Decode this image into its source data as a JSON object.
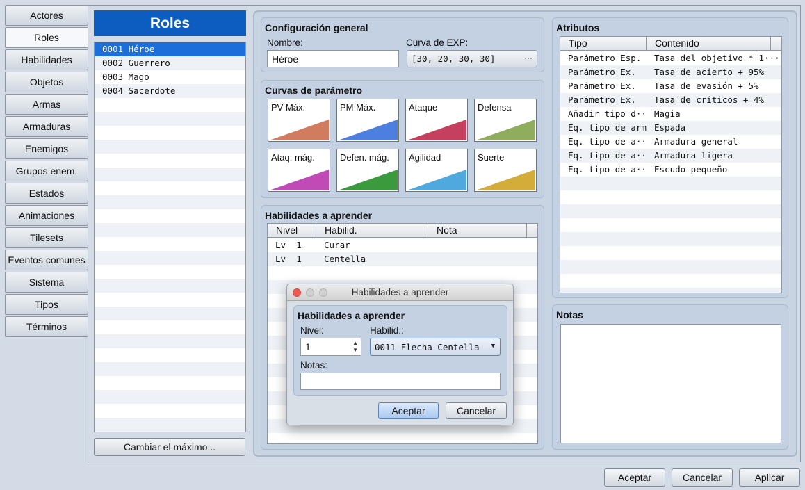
{
  "nav": [
    {
      "label": "Actores",
      "active": false
    },
    {
      "label": "Roles",
      "active": true
    },
    {
      "label": "Habilidades",
      "active": false
    },
    {
      "label": "Objetos",
      "active": false
    },
    {
      "label": "Armas",
      "active": false
    },
    {
      "label": "Armaduras",
      "active": false
    },
    {
      "label": "Enemigos",
      "active": false
    },
    {
      "label": "Grupos enem.",
      "active": false
    },
    {
      "label": "Estados",
      "active": false
    },
    {
      "label": "Animaciones",
      "active": false
    },
    {
      "label": "Tilesets",
      "active": false
    },
    {
      "label": "Eventos comunes",
      "active": false
    },
    {
      "label": "Sistema",
      "active": false
    },
    {
      "label": "Tipos",
      "active": false
    },
    {
      "label": "Términos",
      "active": false
    }
  ],
  "roles": {
    "title": "Roles",
    "items": [
      "0001 Héroe",
      "0002 Guerrero",
      "0003 Mago",
      "0004 Sacerdote"
    ],
    "change_max_label": "Cambiar el máximo..."
  },
  "general": {
    "title": "Configuración general",
    "name_label": "Nombre:",
    "name_value": "Héroe",
    "exp_label": "Curva de EXP:",
    "exp_value": "[30, 20, 30, 30]",
    "exp_button": "···"
  },
  "curves": {
    "title": "Curvas de parámetro",
    "items": [
      {
        "label": "PV Máx.",
        "color": "#d27c5f"
      },
      {
        "label": "PM Máx.",
        "color": "#4d7fe0"
      },
      {
        "label": "Ataque",
        "color": "#c63f5e"
      },
      {
        "label": "Defensa",
        "color": "#8fad5d"
      },
      {
        "label": "Ataq. mág.",
        "color": "#c04ab6"
      },
      {
        "label": "Defen. mág.",
        "color": "#3a9a3c"
      },
      {
        "label": "Agilidad",
        "color": "#4ea9de"
      },
      {
        "label": "Suerte",
        "color": "#d4ac3a"
      }
    ]
  },
  "skills": {
    "title": "Habilidades a aprender",
    "headers": [
      "Nivel",
      "Habilid.",
      "Nota"
    ],
    "rows": [
      {
        "level": "Lv  1",
        "skill": "Curar",
        "note": ""
      },
      {
        "level": "Lv  1",
        "skill": "Centella",
        "note": ""
      }
    ]
  },
  "attributes": {
    "title": "Atributos",
    "headers": [
      "Tipo",
      "Contenido"
    ],
    "rows": [
      {
        "type": "Parámetro Esp.",
        "content": "Tasa del objetivo * 1···"
      },
      {
        "type": "Parámetro Ex.",
        "content": "Tasa de acierto + 95%"
      },
      {
        "type": "Parámetro Ex.",
        "content": "Tasa de evasión + 5%"
      },
      {
        "type": "Parámetro Ex.",
        "content": "Tasa de críticos + 4%"
      },
      {
        "type": "Añadir tipo d···",
        "content": "Magia"
      },
      {
        "type": "Eq. tipo de arma",
        "content": "Espada"
      },
      {
        "type": "Eq. tipo de a···",
        "content": "Armadura general"
      },
      {
        "type": "Eq. tipo de a···",
        "content": "Armadura ligera"
      },
      {
        "type": "Eq. tipo de a···",
        "content": "Escudo pequeño"
      }
    ]
  },
  "notes": {
    "title": "Notas"
  },
  "dialog": {
    "window_title": "Habilidades a aprender",
    "group_title": "Habilidades a aprender",
    "level_label": "Nivel:",
    "level_value": "1",
    "skill_label": "Habilid.:",
    "skill_value": "0011 Flecha Centella",
    "notes_label": "Notas:",
    "notes_value": "",
    "ok_label": "Aceptar",
    "cancel_label": "Cancelar"
  },
  "footer": {
    "ok_label": "Aceptar",
    "cancel_label": "Cancelar",
    "apply_label": "Aplicar"
  },
  "colors": {
    "roles_header": "#0d5cbf",
    "selection": "#1c6fd8",
    "close_dot": "#ee5a52"
  }
}
